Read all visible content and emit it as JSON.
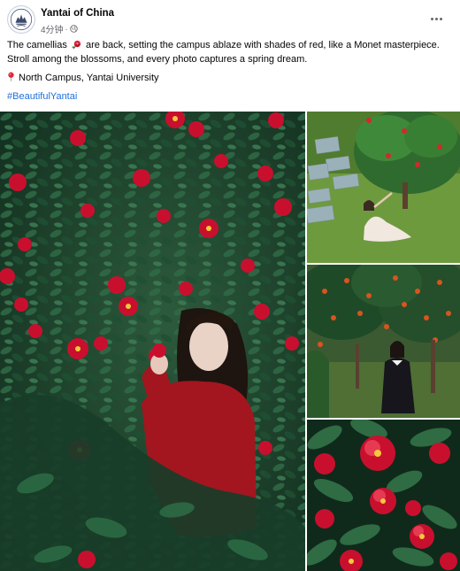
{
  "post": {
    "page_name": "Yantai of China",
    "timestamp": "4分钟",
    "separator": "·",
    "avatar_icon": "yantai-logo-icon",
    "privacy_icon": "globe-icon",
    "more_icon": "more-options-icon",
    "caption": {
      "part1": "The camellias",
      "flower_icon": "camellia-flower-emoji",
      "part2": "are back, setting the campus ablaze with shades of red, like a Monet masterpiece.",
      "line2": "Stroll among the blossoms, and every photo captures a spring dream.",
      "location_icon": "pin-emoji",
      "location": "North Campus, Yantai University",
      "hashtag": "#BeautifulYantai"
    },
    "colors": {
      "link": "#216fdb",
      "secondary_text": "#65676b",
      "camellia_red": "#c8102e",
      "leaf_green": "#1f4a2c"
    }
  }
}
